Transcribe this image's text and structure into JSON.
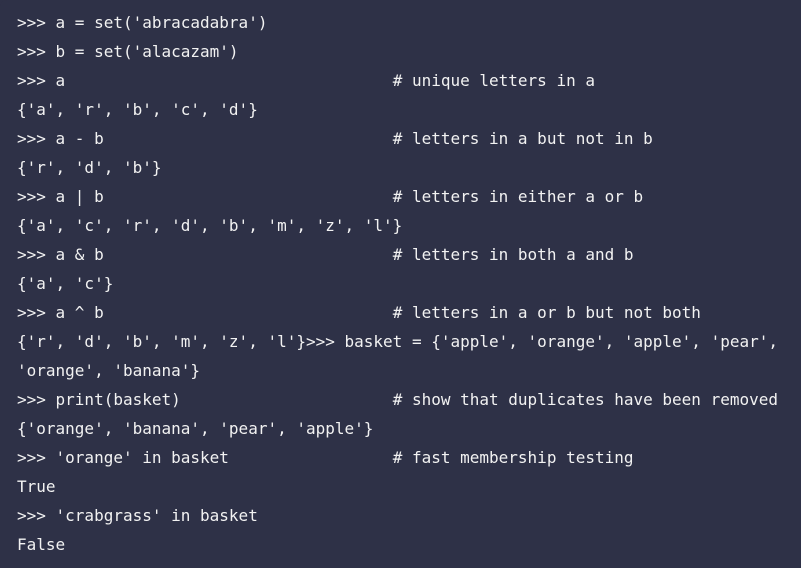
{
  "theme": {
    "background": "#2e3147",
    "foreground": "#f2f2f2"
  },
  "console": {
    "prompt": ">>> ",
    "comment_column": 39,
    "lines": [
      {
        "kind": "input",
        "text": ">>> a = set('abracadabra')",
        "comment": ""
      },
      {
        "kind": "input",
        "text": ">>> b = set('alacazam')",
        "comment": ""
      },
      {
        "kind": "input",
        "text": ">>> a",
        "comment": "# unique letters in a"
      },
      {
        "kind": "output",
        "text": "{'a', 'r', 'b', 'c', 'd'}",
        "comment": ""
      },
      {
        "kind": "input",
        "text": ">>> a - b",
        "comment": "# letters in a but not in b"
      },
      {
        "kind": "output",
        "text": "{'r', 'd', 'b'}",
        "comment": ""
      },
      {
        "kind": "input",
        "text": ">>> a | b",
        "comment": "# letters in either a or b"
      },
      {
        "kind": "output",
        "text": "{'a', 'c', 'r', 'd', 'b', 'm', 'z', 'l'}",
        "comment": ""
      },
      {
        "kind": "input",
        "text": ">>> a & b",
        "comment": "# letters in both a and b"
      },
      {
        "kind": "output",
        "text": "{'a', 'c'}",
        "comment": ""
      },
      {
        "kind": "input",
        "text": ">>> a ^ b",
        "comment": "# letters in a or b but not both"
      },
      {
        "kind": "wrapped",
        "text": "{'r', 'd', 'b', 'm', 'z', 'l'}>>> basket = {'apple', 'orange', 'apple', 'pear',",
        "comment": ""
      },
      {
        "kind": "wrapped-cont",
        "text": "'orange', 'banana'}",
        "comment": ""
      },
      {
        "kind": "input",
        "text": ">>> print(basket)",
        "comment": "# show that duplicates have been removed"
      },
      {
        "kind": "output",
        "text": "{'orange', 'banana', 'pear', 'apple'}",
        "comment": ""
      },
      {
        "kind": "input",
        "text": ">>> 'orange' in basket",
        "comment": "# fast membership testing"
      },
      {
        "kind": "output",
        "text": "True",
        "comment": ""
      },
      {
        "kind": "input",
        "text": ">>> 'crabgrass' in basket",
        "comment": ""
      },
      {
        "kind": "output",
        "text": "False",
        "comment": ""
      }
    ]
  }
}
